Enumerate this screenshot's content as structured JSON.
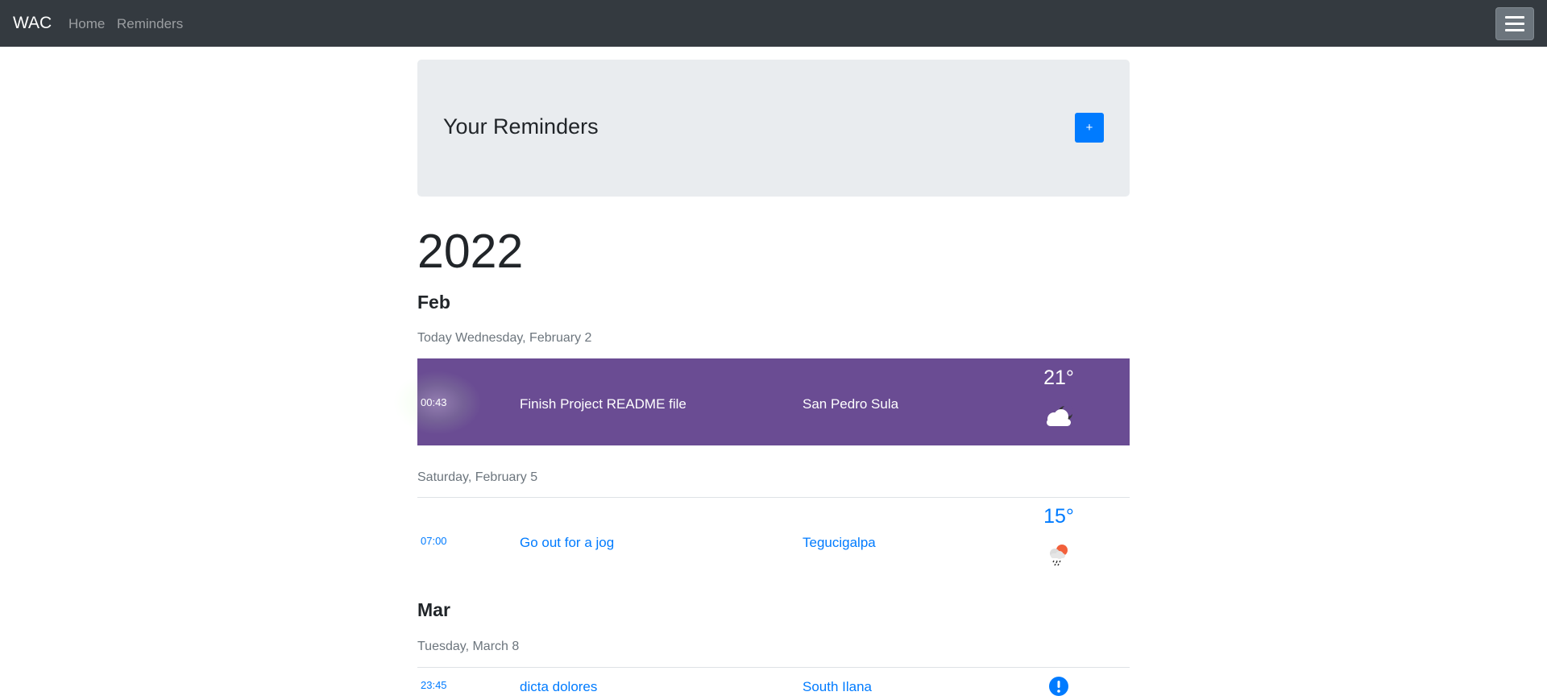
{
  "navbar": {
    "brand": "WAC",
    "links": [
      "Home",
      "Reminders"
    ],
    "toggler_icon": "hamburger-icon"
  },
  "jumbotron": {
    "title": "Your Reminders",
    "add_label": "+"
  },
  "year": "2022",
  "months": [
    {
      "name": "Feb",
      "days": [
        {
          "label": "Today Wednesday, February 2",
          "reminders": [
            {
              "time": "00:43",
              "title": "Finish Project README file",
              "city": "San Pedro Sula",
              "temp": "21°",
              "weather_icon": "night-cloudy-icon",
              "highlighted": true
            }
          ]
        },
        {
          "label": "Saturday, February 5",
          "reminders": [
            {
              "time": "07:00",
              "title": "Go out for a jog",
              "city": "Tegucigalpa",
              "temp": "15°",
              "weather_icon": "sun-rain-icon",
              "highlighted": false
            }
          ]
        }
      ]
    },
    {
      "name": "Mar",
      "days": [
        {
          "label": "Tuesday, March 8",
          "reminders": [
            {
              "time": "23:45",
              "title": "dicta dolores",
              "city": "South Ilana",
              "temp": "",
              "weather_icon": "alert-icon",
              "highlighted": false
            }
          ]
        }
      ]
    }
  ],
  "colors": {
    "navbar": "#343a40",
    "accent": "#007bff",
    "highlight_row": "#6a4c93",
    "jumbotron": "#e9ecef"
  }
}
